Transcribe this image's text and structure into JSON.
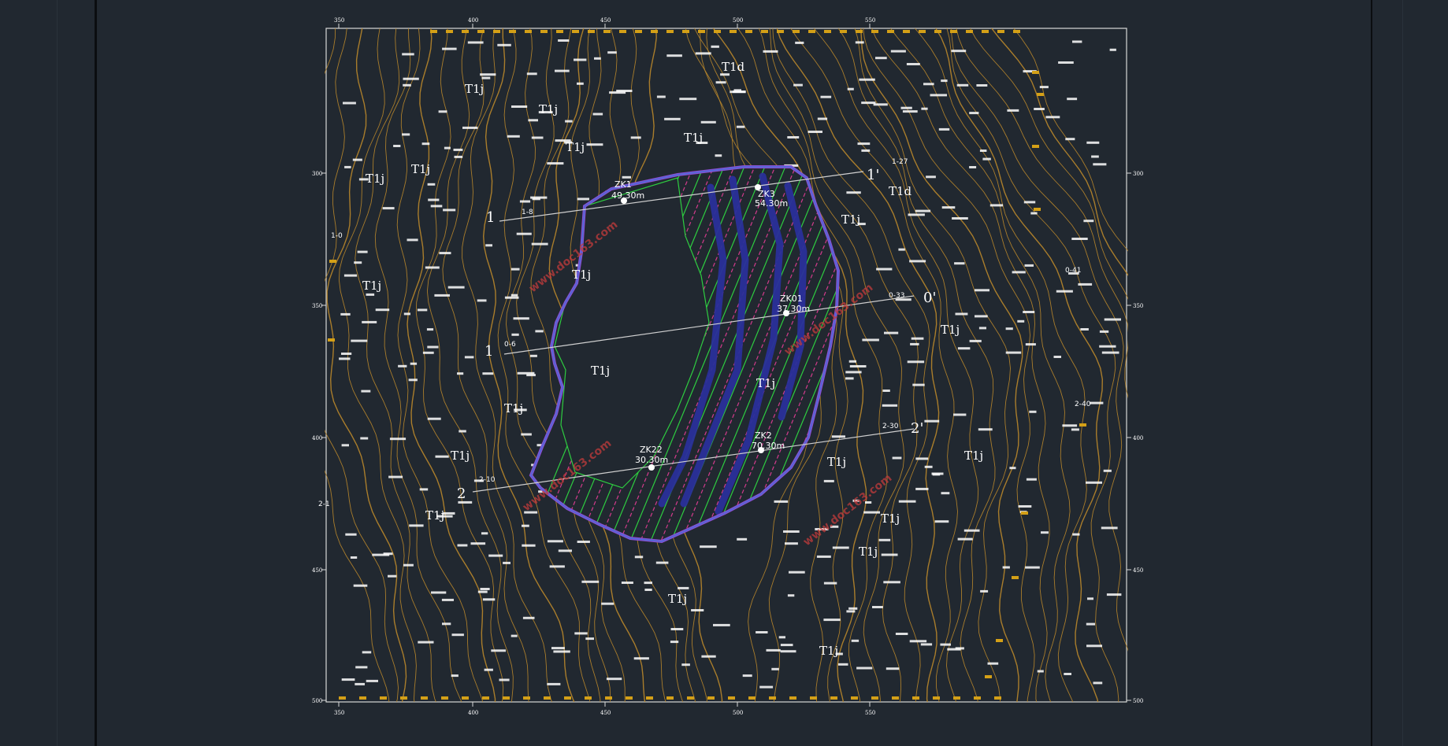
{
  "colors": {
    "background": "#212830",
    "contour": "#b8862b",
    "pit_outline": "#8a4fd0",
    "bench_green": "#2ecc40",
    "bench_magenta": "#d23b8c",
    "ramp": "#2a2f9a",
    "section_line": "#d0d0d0",
    "label": "#ffffff",
    "marker": "#d4a017",
    "watermark": "#c23b3b"
  },
  "frame": {
    "corner_ticks_top": [
      "350",
      "400",
      "450",
      "500",
      "550"
    ],
    "corner_ticks_bottom": [
      "350",
      "400",
      "450",
      "500",
      "550"
    ],
    "side_ticks": [
      "300",
      "350",
      "400",
      "450",
      "500"
    ]
  },
  "strata_labels": [
    "T1d",
    "T1j",
    "T1j",
    "T1j",
    "T1j",
    "T1j",
    "T1j",
    "T1d",
    "T1j",
    "T1j",
    "T1j",
    "T1j",
    "T1j",
    "T1j",
    "T1j",
    "T1j",
    "T1j",
    "T1j",
    "T1j",
    "T1j",
    "T1j",
    "T1j",
    "T1j"
  ],
  "section_lines": [
    {
      "id": "1",
      "start_label": "1",
      "end_label": "1'",
      "start_note": "1-8",
      "end_note": "1-27"
    },
    {
      "id": "0",
      "start_label": "0",
      "end_label": "0'",
      "start_note": "0-6",
      "end_note": "0-33"
    },
    {
      "id": "2",
      "start_label": "2",
      "end_label": "2'",
      "start_note": "2-10",
      "end_note": "2-30"
    }
  ],
  "boreholes": [
    {
      "name": "ZK1",
      "value": "49.30m"
    },
    {
      "name": "ZK3",
      "value": "54.30m"
    },
    {
      "name": "ZK01",
      "value": "37.30m"
    },
    {
      "name": "ZK2",
      "value": "70.30m"
    },
    {
      "name": "ZK22",
      "value": "30.30m"
    }
  ],
  "edge_points": [
    "1-0",
    "0-41",
    "2-40",
    "2-1"
  ],
  "watermark": "www.doc163.com"
}
